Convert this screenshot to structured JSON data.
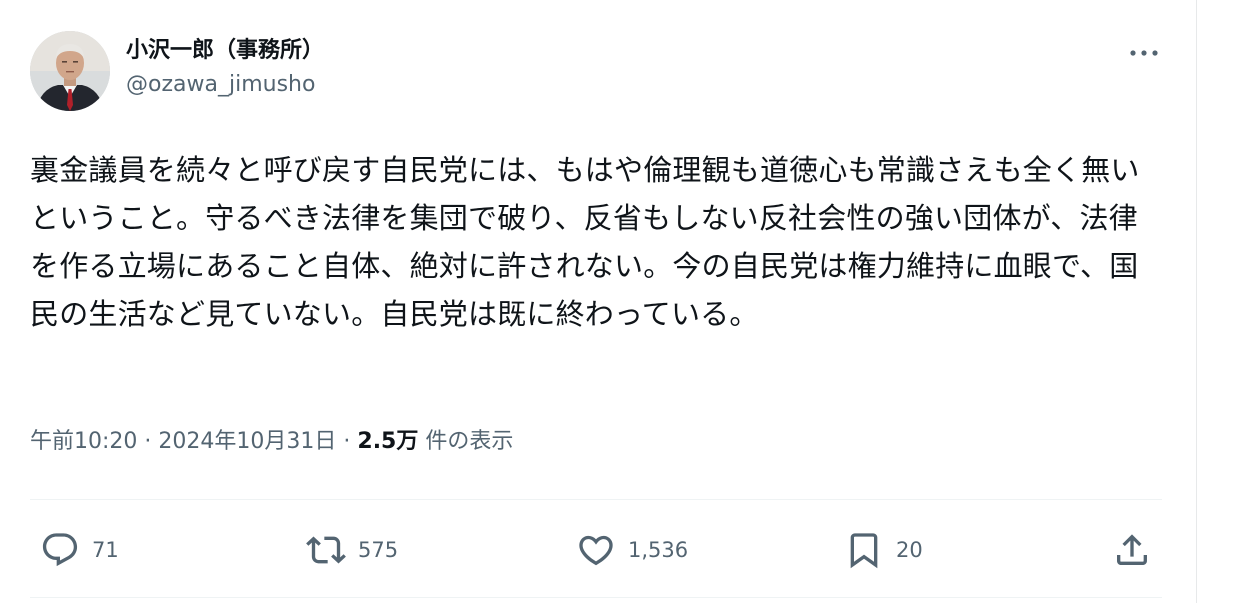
{
  "tweet": {
    "author": {
      "display_name": "小沢一郎（事務所）",
      "handle": "@ozawa_jimusho"
    },
    "text": "裏金議員を続々と呼び戻す自民党には、もはや倫理観も道徳心も常識さえも全く無いということ。守るべき法律を集団で破り、反省もしない反社会性の強い団体が、法律を作る立場にあること自体、絶対に許されない。今の自民党は権力維持に血眼で、国民の生活など見ていない。自民党は既に終わっている。",
    "meta": {
      "time": "午前10:20",
      "separator": "·",
      "date": "2024年10月31日",
      "views_count": "2.5万",
      "views_label": "件の表示"
    },
    "actions": {
      "reply": {
        "icon": "reply-icon",
        "count": "71"
      },
      "repost": {
        "icon": "repost-icon",
        "count": "575"
      },
      "like": {
        "icon": "heart-icon",
        "count": "1,536"
      },
      "bookmark": {
        "icon": "bookmark-icon",
        "count": "20"
      },
      "share": {
        "icon": "share-icon"
      }
    }
  },
  "colors": {
    "text_primary": "#0f1419",
    "text_secondary": "#536471",
    "divider": "#eff3f4"
  }
}
